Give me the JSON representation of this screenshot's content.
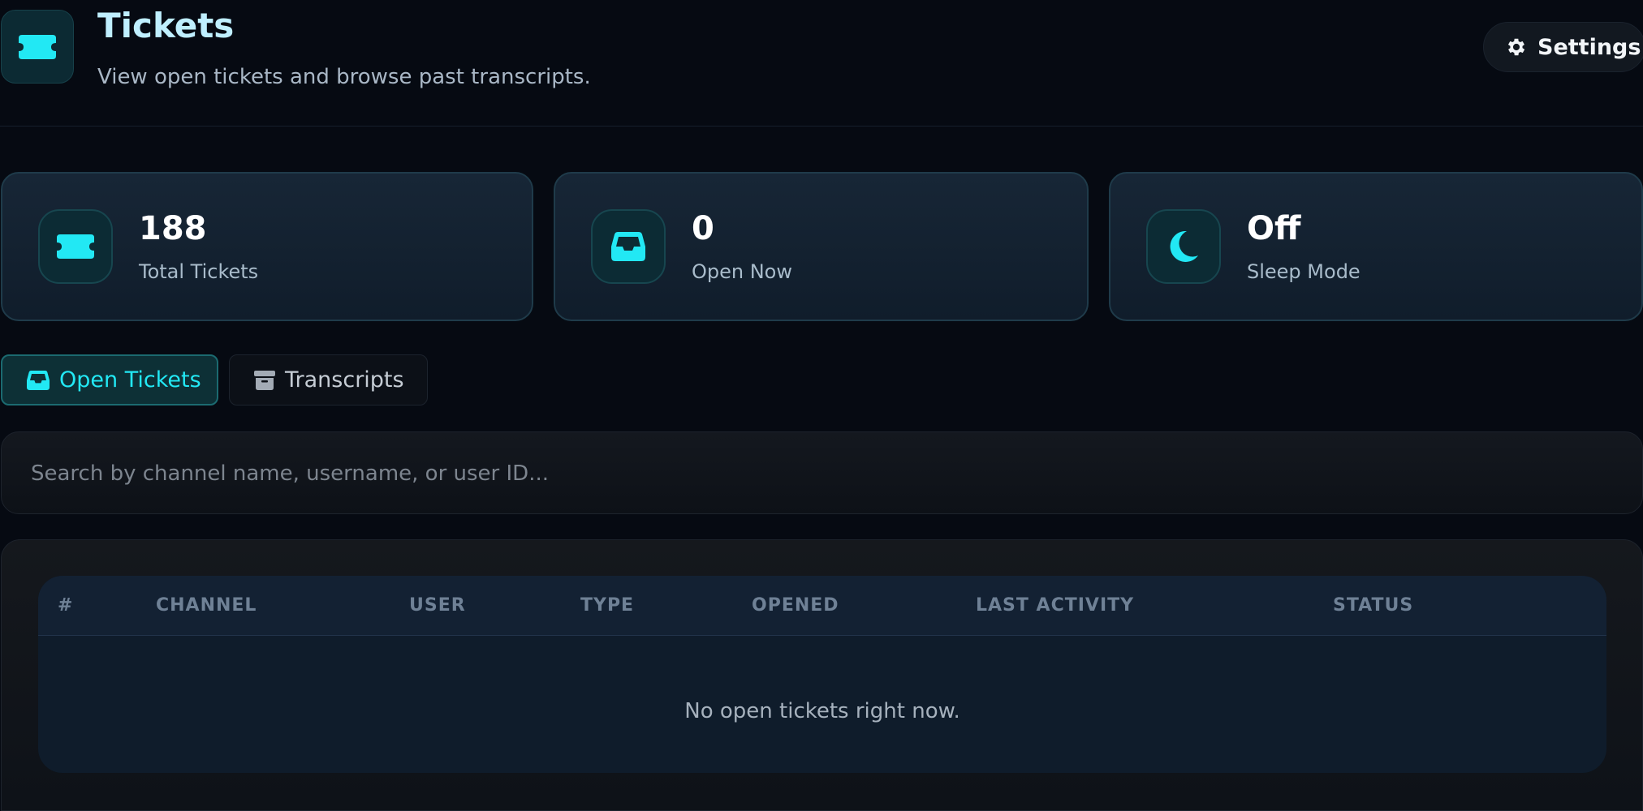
{
  "header": {
    "title": "Tickets",
    "subtitle": "View open tickets and browse past transcripts.",
    "icon": "ticket-icon",
    "settings_label": "Settings"
  },
  "stats": [
    {
      "value": "188",
      "label": "Total Tickets",
      "icon": "ticket-icon"
    },
    {
      "value": "0",
      "label": "Open Now",
      "icon": "inbox-icon"
    },
    {
      "value": "Off",
      "label": "Sleep Mode",
      "icon": "moon-icon"
    }
  ],
  "tabs": [
    {
      "label": "Open Tickets",
      "icon": "inbox-icon",
      "active": true
    },
    {
      "label": "Transcripts",
      "icon": "archive-icon",
      "active": false
    }
  ],
  "search": {
    "placeholder": "Search by channel name, username, or user ID...",
    "value": ""
  },
  "table": {
    "columns": [
      "#",
      "CHANNEL",
      "USER",
      "TYPE",
      "OPENED",
      "LAST ACTIVITY",
      "STATUS"
    ],
    "rows": [],
    "empty_message": "No open tickets right now."
  },
  "colors": {
    "accent": "#22e8f4",
    "background": "#060a12",
    "card": "#13202f"
  }
}
